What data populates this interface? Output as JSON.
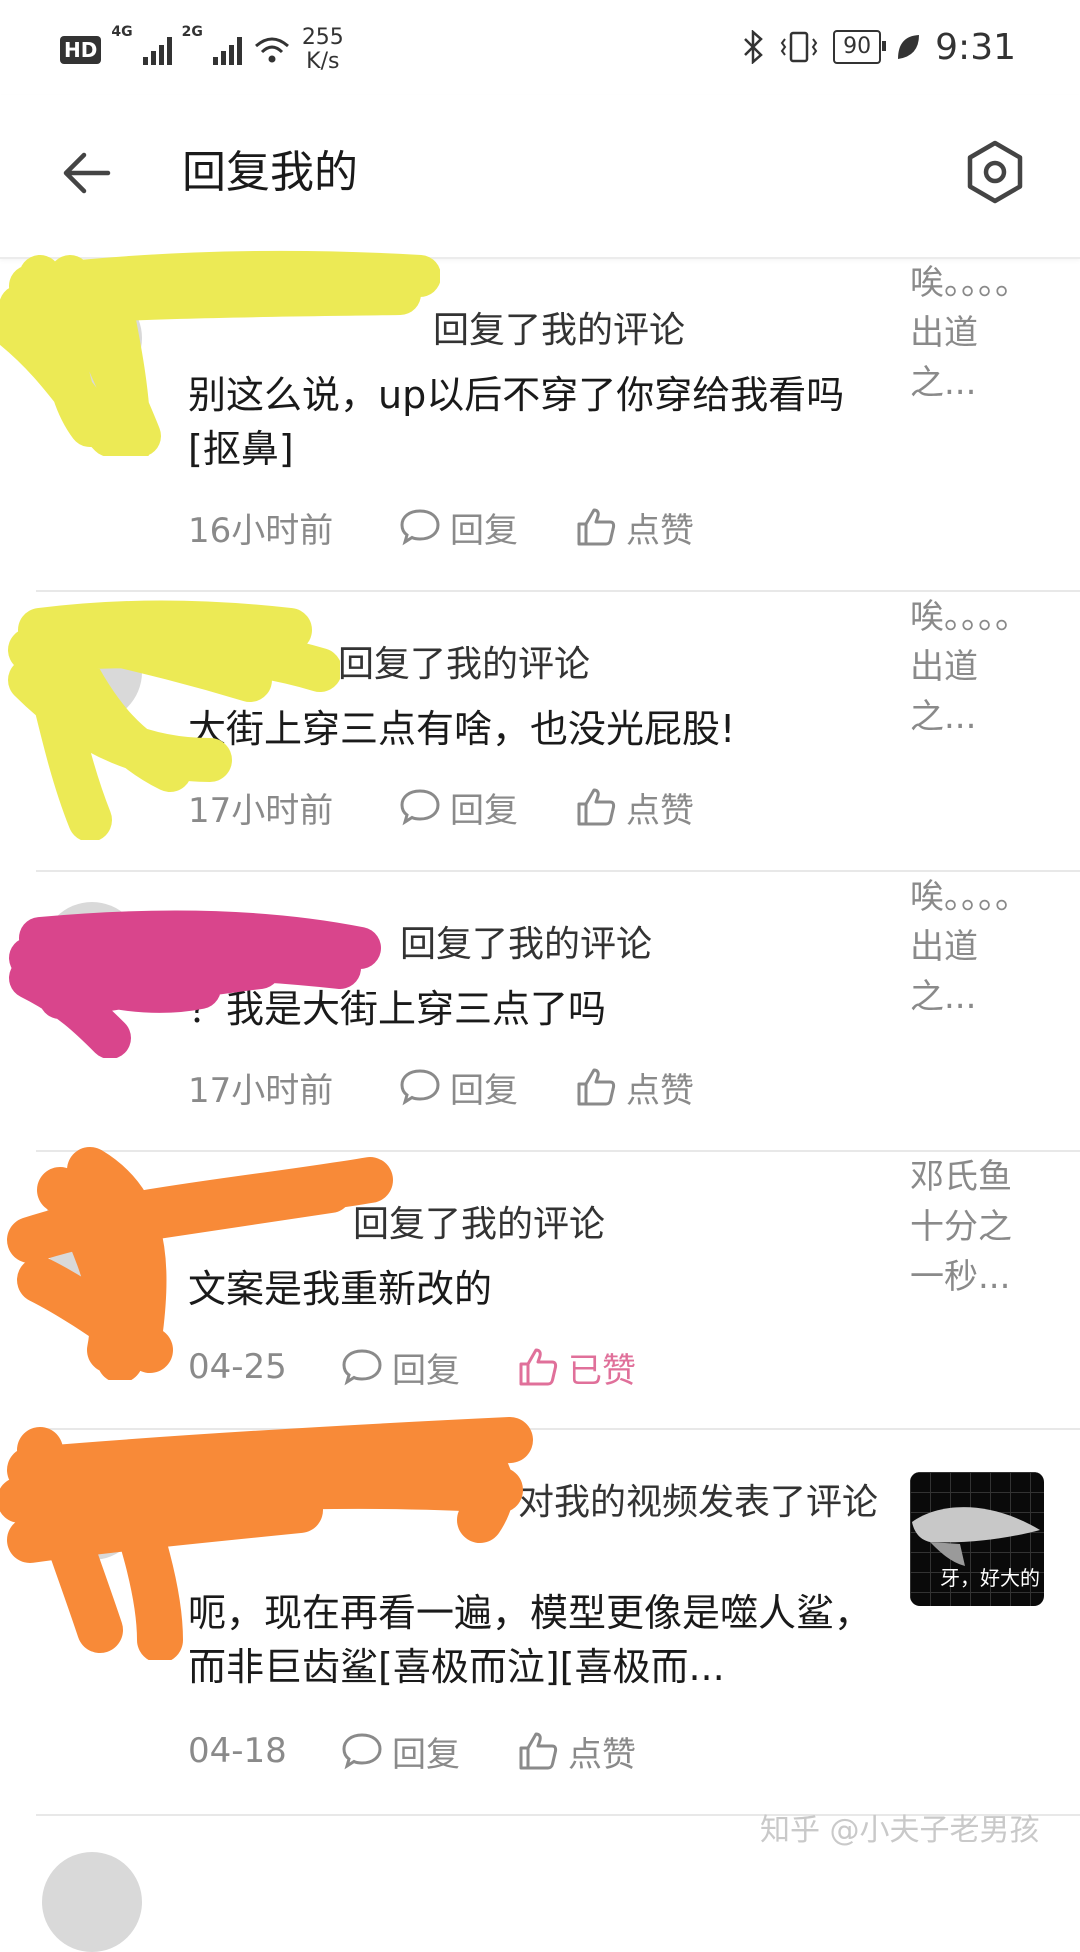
{
  "status_bar": {
    "hd": "HD",
    "net1": "4G",
    "net2": "2G",
    "speed_value": "255",
    "speed_unit": "K/s",
    "battery": "90",
    "time": "9:31"
  },
  "header": {
    "title": "回复我的",
    "back_icon": "arrow-left-icon",
    "settings_icon": "hexagon-settings-icon"
  },
  "notifications": [
    {
      "action_text": "回复了我的评论",
      "content": "别这么说，up以后不穿了你穿给我看吗[抠鼻]",
      "time": "16小时前",
      "reply_label": "回复",
      "like_label": "点赞",
      "liked": false,
      "ref_text": "唉。。。。出道之..."
    },
    {
      "action_text": "回复了我的评论",
      "content": "大街上穿三点有啥，也没光屁股!",
      "time": "17小时前",
      "reply_label": "回复",
      "like_label": "点赞",
      "liked": false,
      "ref_text": "唉。。。。出道之..."
    },
    {
      "action_text": "回复了我的评论",
      "content": "？我是大街上穿三点了吗",
      "time": "17小时前",
      "reply_label": "回复",
      "like_label": "点赞",
      "liked": false,
      "ref_text": "唉。。。。出道之..."
    },
    {
      "action_text": "回复了我的评论",
      "content": "文案是我重新改的",
      "time": "04-25",
      "reply_label": "回复",
      "like_label": "已赞",
      "liked": true,
      "ref_text": "邓氏鱼十分之一秒..."
    },
    {
      "action_text": "对我的视频发表了评论",
      "content": "呃，现在再看一遍，模型更像是噬人鲨，而非巨齿鲨[喜极而泣][喜极而...",
      "time": "04-18",
      "reply_label": "回复",
      "like_label": "点赞",
      "liked": false,
      "thumb_caption": "牙，好大的"
    }
  ],
  "watermark": "知乎 @小夫子老男孩",
  "colors": {
    "accent_liked": "#e0709a",
    "scribble_yellow": "#ecea55",
    "scribble_pink": "#d9458c",
    "scribble_orange": "#f88a38"
  }
}
